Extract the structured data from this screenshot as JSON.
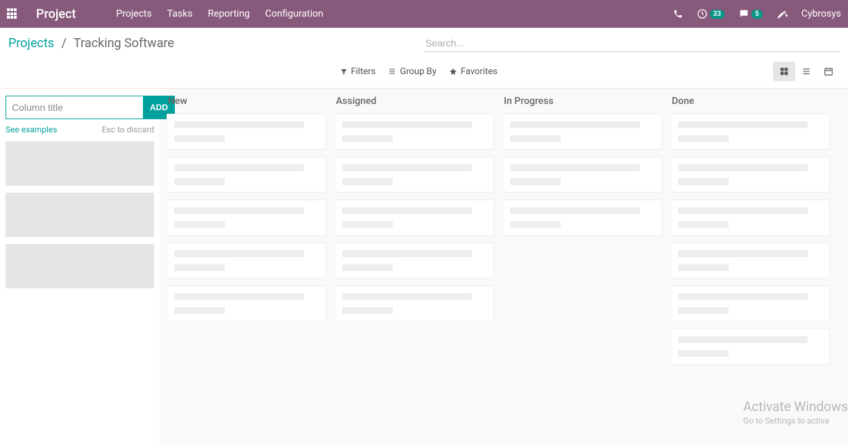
{
  "navbar": {
    "brand": "Project",
    "menu": [
      "Projects",
      "Tasks",
      "Reporting",
      "Configuration"
    ],
    "activity_badge": "33",
    "messages_badge": "5",
    "username": "Cybrosys"
  },
  "breadcrumb": {
    "root": "Projects",
    "current": "Tracking Software"
  },
  "search": {
    "placeholder": "Search..."
  },
  "filters": {
    "filters_label": "Filters",
    "groupby_label": "Group By",
    "favorites_label": "Favorites"
  },
  "quickcolumn": {
    "placeholder": "Column title",
    "add_label": "ADD",
    "examples_label": "See examples",
    "discard_label": "Esc to discard"
  },
  "kanban": {
    "columns": [
      {
        "title": "New",
        "card_count": 5
      },
      {
        "title": "Assigned",
        "card_count": 5
      },
      {
        "title": "In Progress",
        "card_count": 3
      },
      {
        "title": "Done",
        "card_count": 6
      }
    ]
  },
  "watermark": {
    "line1": "Activate Windows",
    "line2": "Go to Settings to activa"
  }
}
